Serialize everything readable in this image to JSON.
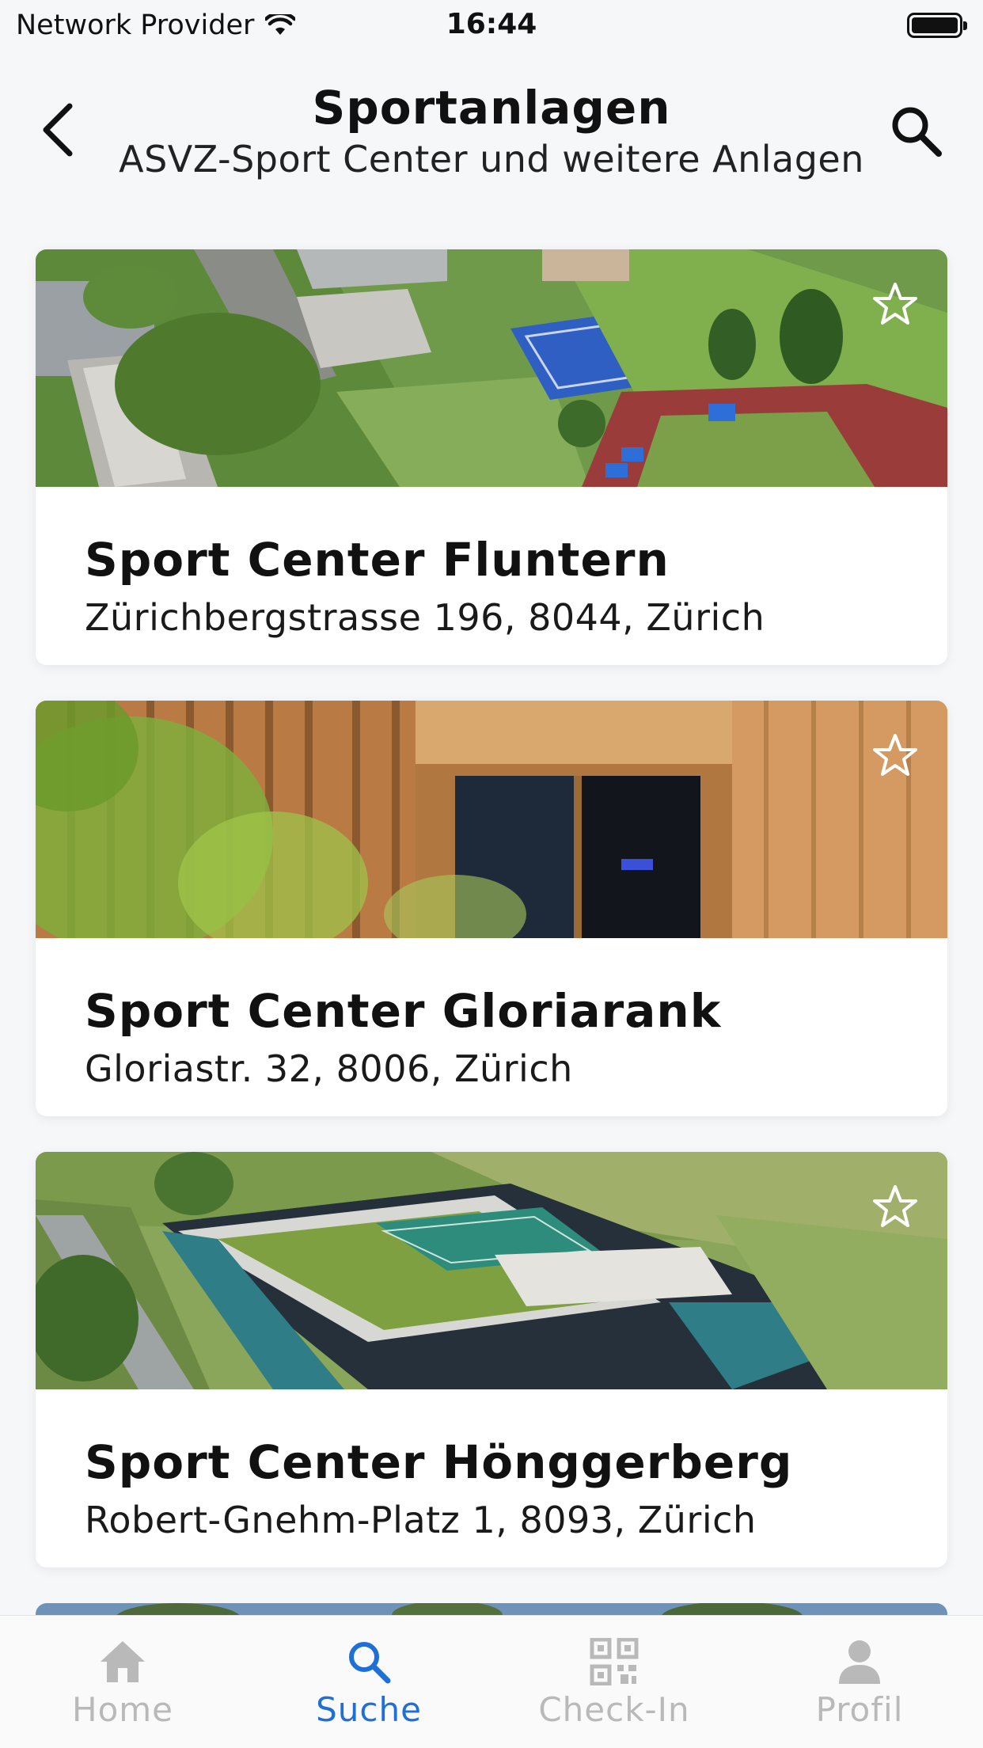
{
  "status_bar": {
    "carrier": "Network Provider",
    "time": "16:44"
  },
  "header": {
    "title": "Sportanlagen",
    "subtitle": "ASVZ-Sport Center und weitere Anlagen"
  },
  "facilities": [
    {
      "name": "Sport Center Fluntern",
      "address": "Zürichbergstrasse 196, 8044, Zürich",
      "favorite": false
    },
    {
      "name": "Sport Center Gloriarank",
      "address": "Gloriastr. 32, 8006, Zürich",
      "favorite": false
    },
    {
      "name": "Sport Center Hönggerberg",
      "address": "Robert-Gnehm-Platz 1, 8093, Zürich",
      "favorite": false
    }
  ],
  "tabbar": {
    "tabs": [
      {
        "label": "Home",
        "icon": "home-icon",
        "active": false
      },
      {
        "label": "Suche",
        "icon": "search-icon",
        "active": true
      },
      {
        "label": "Check-In",
        "icon": "qr-code-icon",
        "active": false
      },
      {
        "label": "Profil",
        "icon": "person-icon",
        "active": false
      }
    ]
  },
  "colors": {
    "accent": "#1e6fd6",
    "inactive": "#b9b9b9",
    "background": "#f6f7f9"
  }
}
